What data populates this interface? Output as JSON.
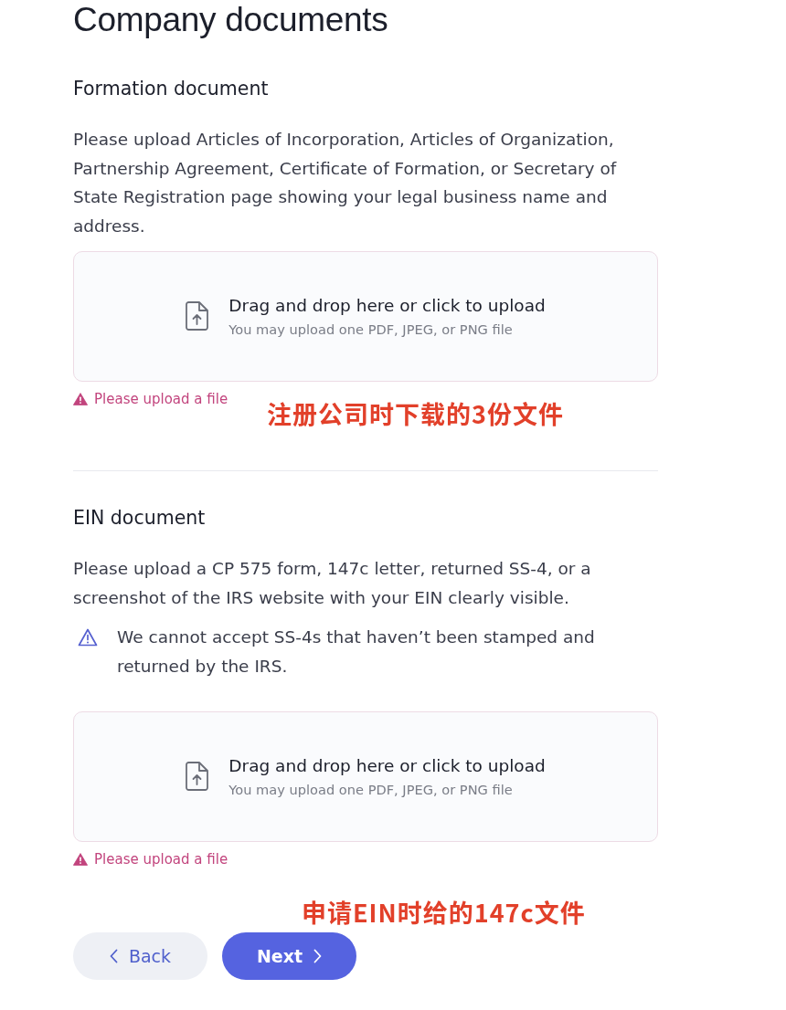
{
  "page": {
    "title": "Company documents"
  },
  "sections": [
    {
      "heading": "Formation document",
      "description": "Please upload Articles of Incorporation, Articles of Organization, Partnership Agreement, Certificate of Formation, or Secretary of State Registration page showing your legal business name and address.",
      "upload": {
        "prompt": "Drag and drop here or click to upload",
        "hint": "You may upload one PDF, JPEG, or PNG file"
      },
      "error": "Please upload a file",
      "annotation": "注册公司时下载的3份文件"
    },
    {
      "heading": "EIN document",
      "description": "Please upload a CP 575 form, 147c letter, returned SS-4, or a screenshot of the IRS website with your EIN clearly visible.",
      "warning": "We cannot accept SS-4s that haven’t been stamped and returned by the IRS.",
      "upload": {
        "prompt": "Drag and drop here or click to upload",
        "hint": "You may upload one PDF, JPEG, or PNG file"
      },
      "error": "Please upload a file"
    }
  ],
  "footer": {
    "annotation": "申请EIN时给的147c文件",
    "buttons": [
      {
        "label": "Back",
        "kind": "back"
      },
      {
        "label": "Next",
        "kind": "next"
      }
    ]
  }
}
